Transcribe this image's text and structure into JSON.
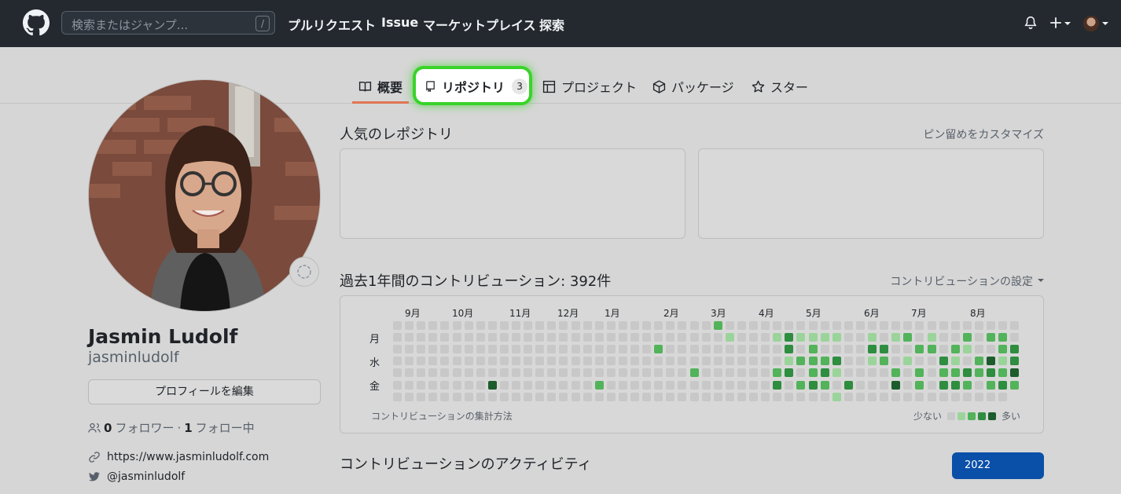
{
  "header": {
    "search_placeholder": "検索またはジャンプ...",
    "search_shortcut": "/",
    "nav": [
      "プルリクエスト",
      "Issue",
      "マーケットプレイス",
      "探索"
    ]
  },
  "tabs": [
    {
      "label": "概要",
      "icon": "book-icon"
    },
    {
      "label": "リポジトリ",
      "icon": "repo-icon",
      "count": "3"
    },
    {
      "label": "プロジェクト",
      "icon": "project-icon"
    },
    {
      "label": "パッケージ",
      "icon": "package-icon"
    },
    {
      "label": "スター",
      "icon": "star-icon"
    }
  ],
  "profile": {
    "name": "Jasmin Ludolf",
    "login": "jasminludolf",
    "edit_label": "プロフィールを編集",
    "followers_count": "0",
    "followers_label": "フォロワー",
    "separator": "·",
    "following_count": "1",
    "following_label": "フォロー中",
    "website": "https://www.jasminludolf.com",
    "twitter": "@jasminludolf"
  },
  "pinned": {
    "title": "人気のレポジトリ",
    "customize": "ピン留めをカスタマイズ"
  },
  "contributions": {
    "title": "過去1年間のコントリビューション: 392件",
    "settings": "コントリビューションの設定",
    "months": [
      "9月",
      "10月",
      "11月",
      "12月",
      "1月",
      "2月",
      "3月",
      "4月",
      "5月",
      "6月",
      "7月",
      "8月"
    ],
    "days": [
      "月",
      "水",
      "金"
    ],
    "footnote": "コントリビューションの集計方法",
    "less": "少ない",
    "more": "多い",
    "colors": [
      "#c8c8c8",
      "#9bd49a",
      "#52b35a",
      "#2e8d3f",
      "#1d5c2b"
    ]
  },
  "activity": {
    "title": "コントリビューションのアクティビティ",
    "year": "2022"
  }
}
